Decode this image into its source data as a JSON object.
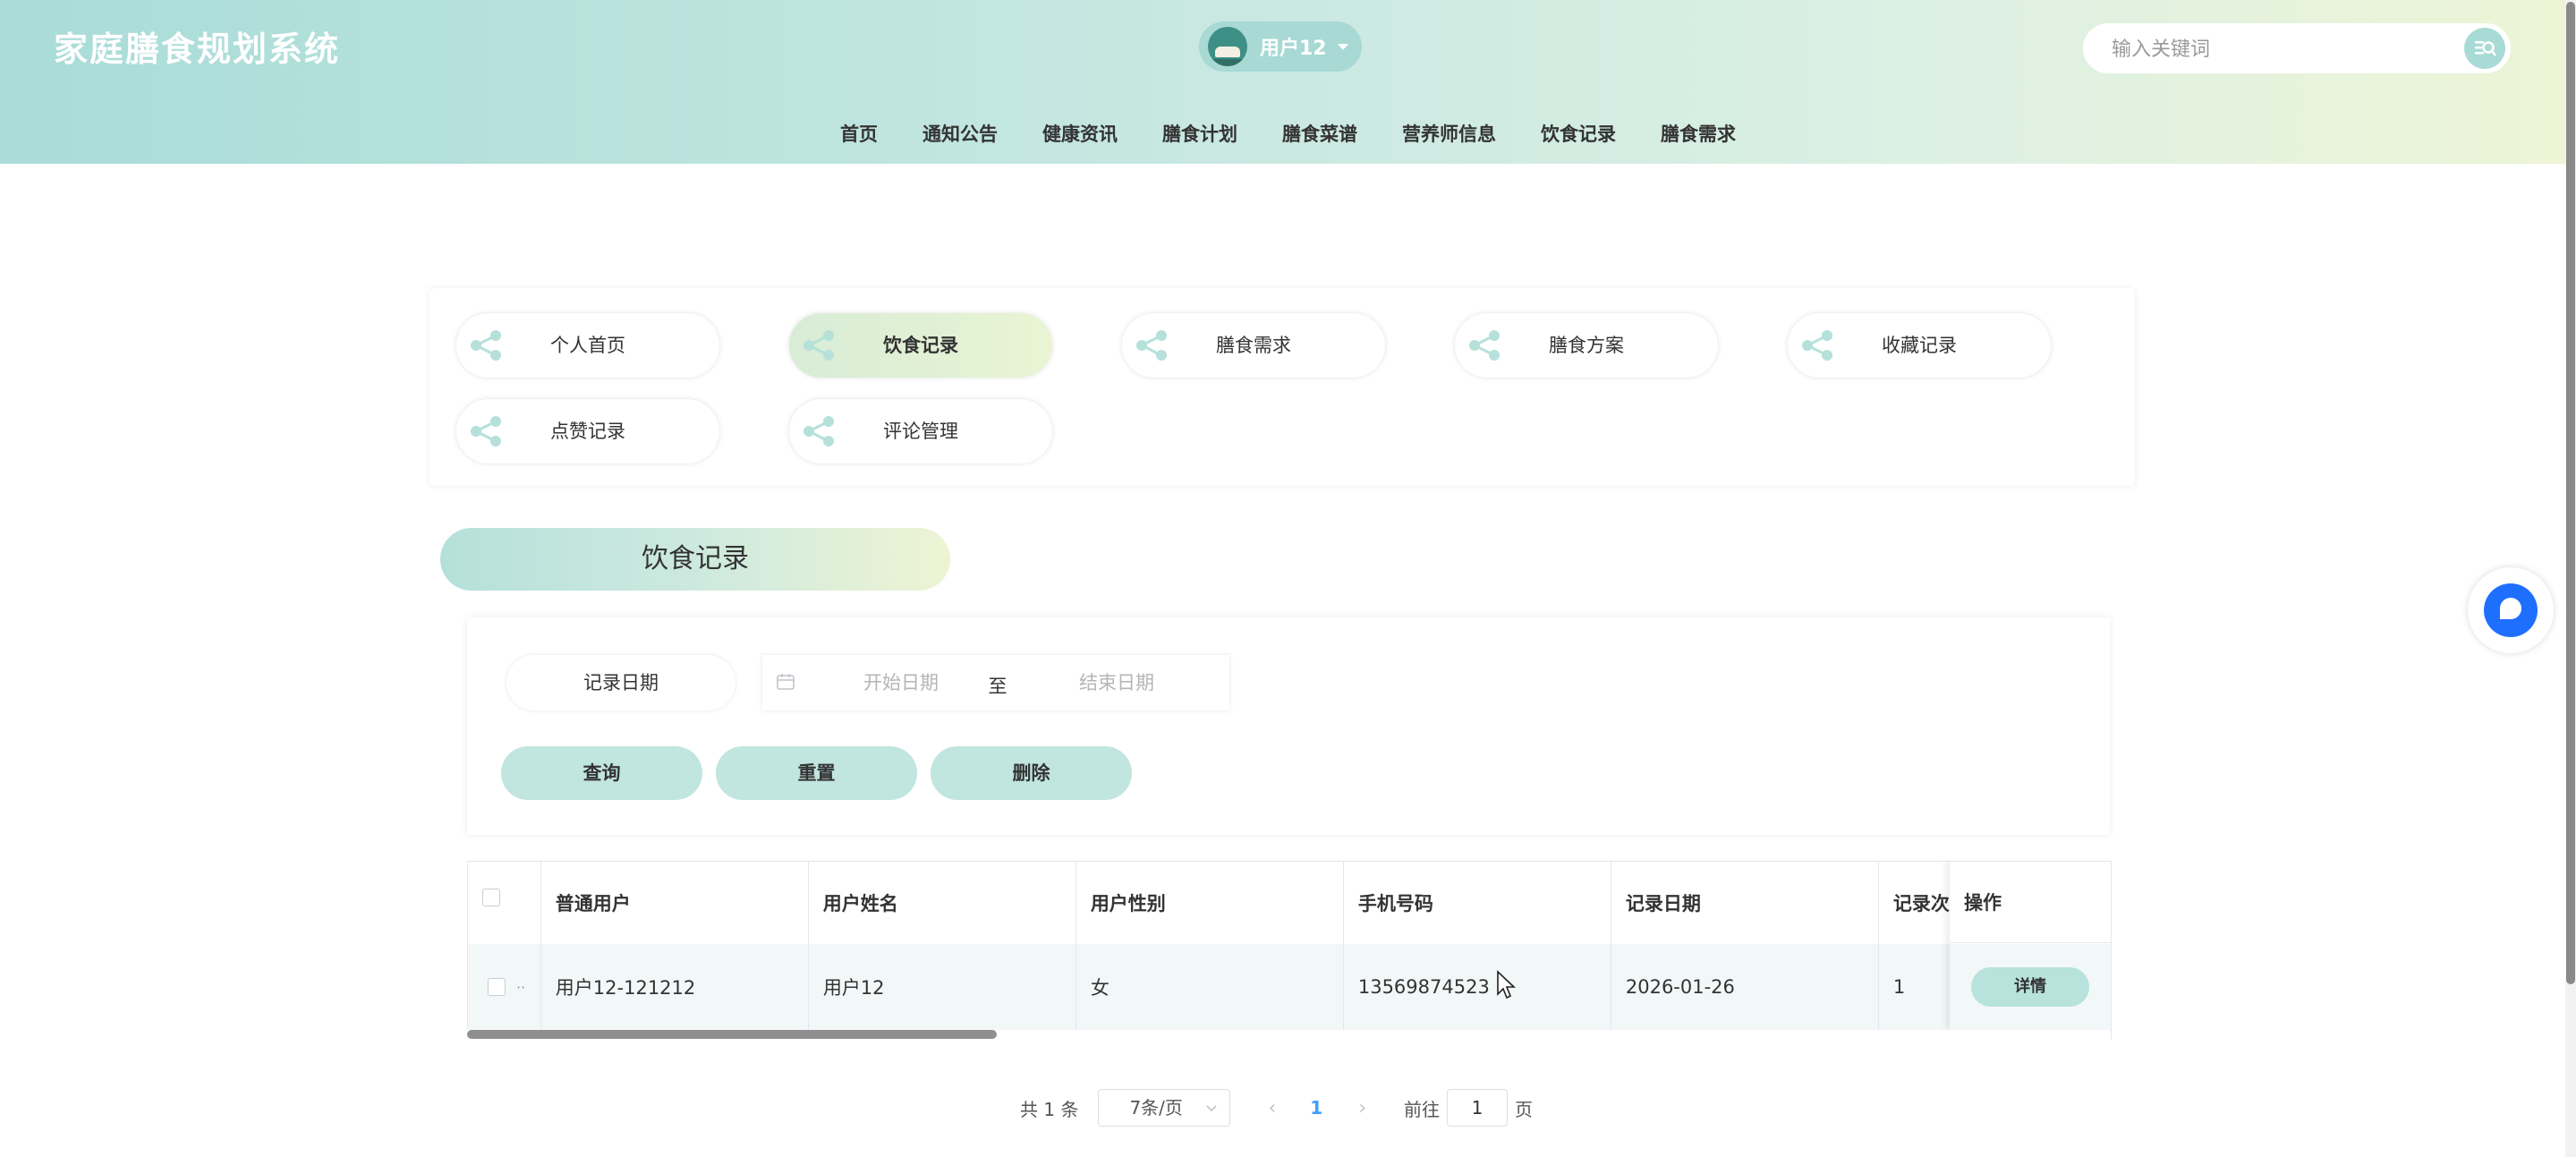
{
  "header": {
    "title": "家庭膳食规划系统",
    "user": {
      "name": "用户12"
    },
    "search": {
      "placeholder": "输入关键词"
    }
  },
  "nav": {
    "items": [
      "首页",
      "通知公告",
      "健康资讯",
      "膳食计划",
      "膳食菜谱",
      "营养师信息",
      "饮食记录",
      "膳食需求"
    ]
  },
  "center_menu": {
    "items": [
      {
        "label": "个人首页",
        "active": false
      },
      {
        "label": "饮食记录",
        "active": true
      },
      {
        "label": "膳食需求",
        "active": false
      },
      {
        "label": "膳食方案",
        "active": false
      },
      {
        "label": "收藏记录",
        "active": false
      },
      {
        "label": "点赞记录",
        "active": false
      },
      {
        "label": "评论管理",
        "active": false
      }
    ]
  },
  "section": {
    "title": "饮食记录"
  },
  "filter": {
    "date_label": "记录日期",
    "start_placeholder": "开始日期",
    "separator": "至",
    "end_placeholder": "结束日期",
    "buttons": {
      "query": "查询",
      "reset": "重置",
      "delete": "删除"
    }
  },
  "table": {
    "columns": [
      "普通用户",
      "用户姓名",
      "用户性别",
      "手机号码",
      "记录日期",
      "记录次"
    ],
    "op_column": "操作",
    "rows": [
      {
        "index_mark": "··",
        "cells": [
          "用户12-121212",
          "用户12",
          "女",
          "13569874523",
          "2026-01-26",
          "1"
        ],
        "action": "详情"
      }
    ]
  },
  "pagination": {
    "total_text": "共 1 条",
    "page_size": "7条/页",
    "current_page": "1",
    "goto_label": "前往",
    "goto_value": "1",
    "page_suffix": "页"
  },
  "colors": {
    "accent": "#a9dbd6",
    "active_pill": "#e3f1d4",
    "pager_active": "#409eff",
    "float_button": "#1f6fff"
  }
}
